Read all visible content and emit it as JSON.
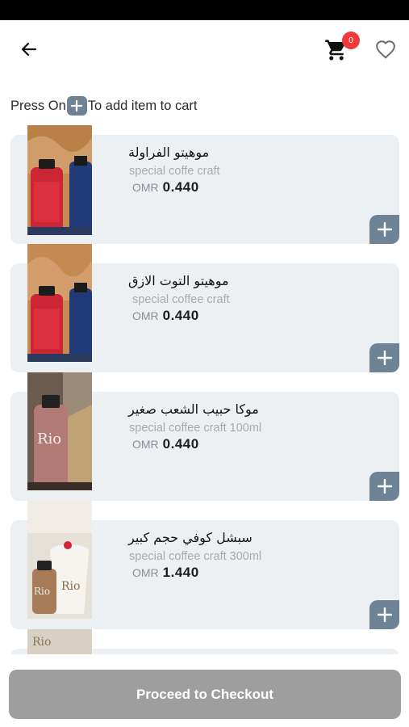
{
  "header": {
    "cart_count": "0"
  },
  "hint": {
    "before": "Press On",
    "after": "To add item to cart"
  },
  "items": [
    {
      "name": "موهيتو الفراولة",
      "desc": "special coffe craft",
      "currency": "OMR",
      "price": "0.440"
    },
    {
      "name": "موهيتو التوت الازق",
      "desc": "special coffee craft",
      "currency": "OMR",
      "price": "0.440"
    },
    {
      "name": "موكا حبيب الشعب صغير",
      "desc": "special coffee craft 100ml",
      "currency": "OMR",
      "price": "0.440"
    },
    {
      "name": "سبشل كوفي حجم كبير",
      "desc": "special coffee craft 300ml",
      "currency": "OMR",
      "price": "1.440"
    }
  ],
  "footer": {
    "checkout_label": "Proceed to Checkout"
  },
  "colors": {
    "accent": "#6f8396",
    "badge": "#f03a3a",
    "card_bg": "#edf0f3",
    "checkout_bg": "#9e9e9e"
  },
  "icons": [
    "back-arrow-icon",
    "cart-icon",
    "heart-icon",
    "plus-icon"
  ]
}
